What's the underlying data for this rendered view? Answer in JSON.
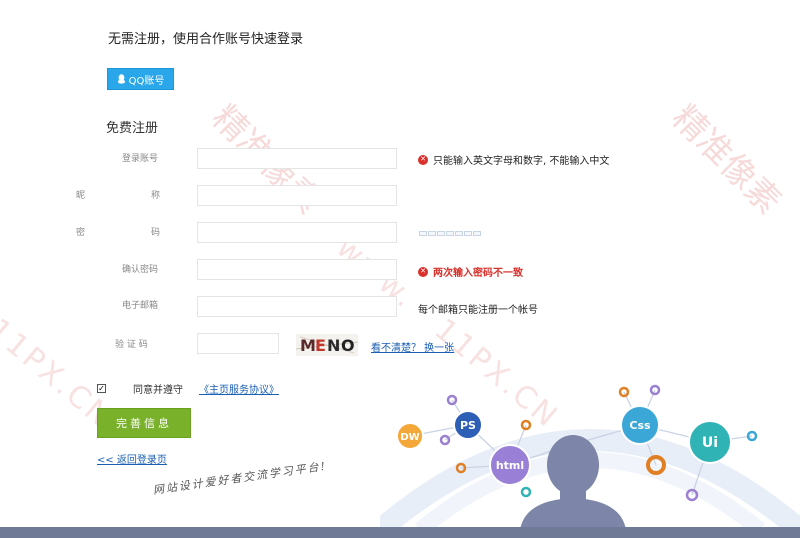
{
  "header": {
    "quick_login_title": "无需注册，使用合作账号快速登录"
  },
  "qq_button": {
    "label": "QQ账号",
    "icon": "qq-icon"
  },
  "register": {
    "title": "免费注册",
    "fields": {
      "account": {
        "label": "登录账号",
        "value": "",
        "error": "只能输入英文字母和数字, 不能输入中文"
      },
      "nickname": {
        "label_left": "昵",
        "label_right": "称",
        "value": ""
      },
      "password": {
        "label_left": "密",
        "label_right": "码",
        "value": ""
      },
      "confirm": {
        "label": "确认密码",
        "value": "",
        "error": "两次输入密码不一致"
      },
      "email": {
        "label": "电子邮箱",
        "value": "",
        "hint": "每个邮箱只能注册一个帐号"
      },
      "captcha": {
        "label": "验 证 码",
        "value": "",
        "image_text": "MENO",
        "refresh_link": "看不清楚？ 换一张"
      }
    },
    "agree": {
      "checked": true,
      "text": "同意并遵守",
      "link": "《主页服务协议》"
    },
    "submit_label": "完善信息",
    "back_link": "<< 返回登录页"
  },
  "watermark": {
    "text": "精准像素",
    "url": "11PX.CN",
    "dash": "www."
  },
  "slogan": "网站设计爱好者交流学习平台!",
  "illustration": {
    "badges": [
      "DW",
      "PS",
      "html",
      "Css",
      "Ui"
    ]
  },
  "colors": {
    "qq_blue": "#2aa6ea",
    "submit_green": "#79b22a",
    "error_red": "#d9302b",
    "link_blue": "#1a5fb4"
  }
}
